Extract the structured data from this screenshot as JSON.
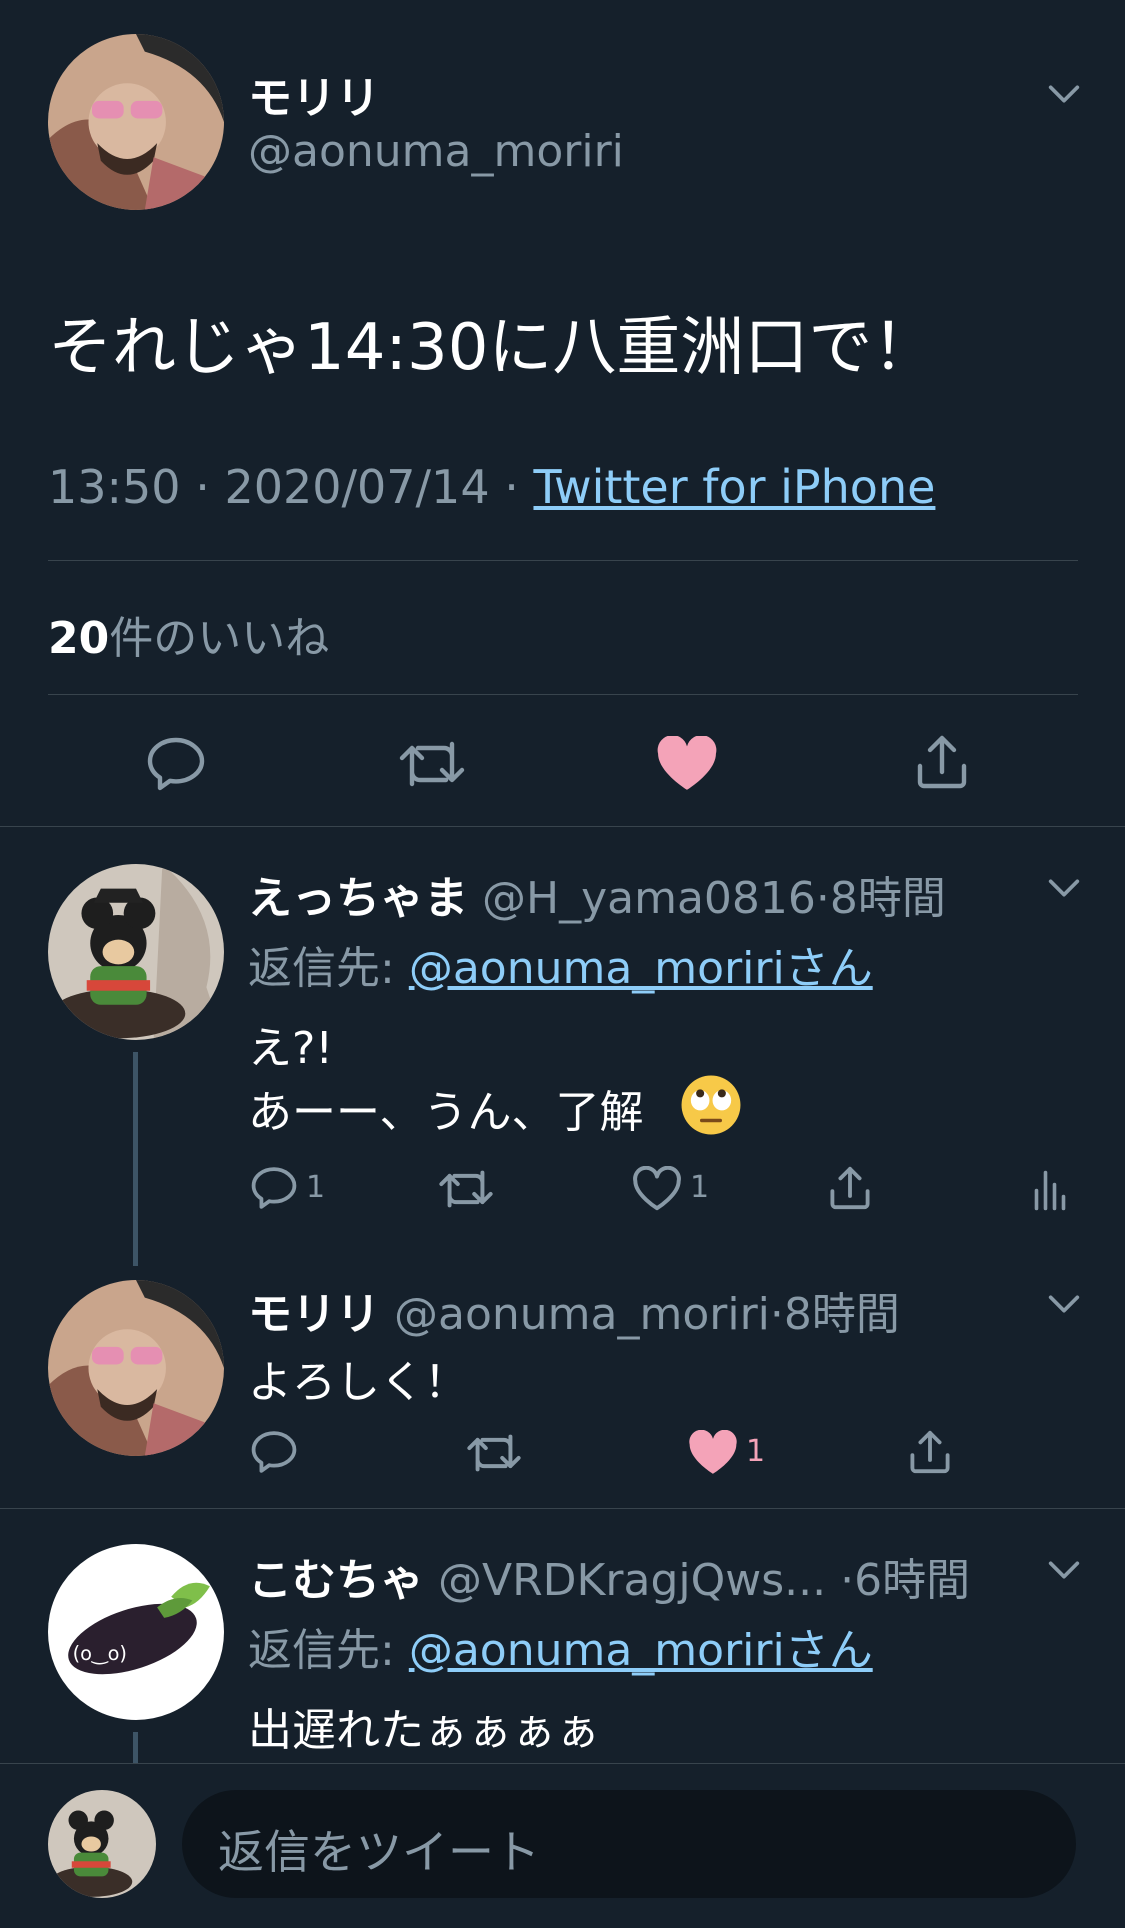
{
  "colors": {
    "background": "#15202b",
    "muted": "#8899a6",
    "link": "#8ecdf8",
    "like": "#f4a3b8",
    "divider": "#38444d"
  },
  "main_tweet": {
    "display_name": "モリリ",
    "handle": "@aonuma_moriri",
    "text": "それじゃ14:30に八重洲口で！",
    "time": "13:50",
    "date": "2020/07/14",
    "source": "Twitter for iPhone",
    "separator": " · ",
    "likes_count": "20",
    "likes_suffix": "件のいいね",
    "icons": [
      "reply-icon",
      "retweet-icon",
      "heart-filled-icon",
      "share-icon"
    ]
  },
  "replies": [
    {
      "display_name": "えっちゃま",
      "handle": "@H_yama0816",
      "time": "8時間",
      "dot": "·",
      "reply_to_label": "返信先: ",
      "reply_to": "@aonuma_moririさん",
      "lines": [
        "え?!",
        "あーー、うん、了解"
      ],
      "emoji": "face-with-rolling-eyes",
      "reply_count": "1",
      "like_count": "1"
    },
    {
      "display_name": "モリリ",
      "handle": "@aonuma_moriri",
      "time": "8時間",
      "dot": "·",
      "lines": [
        "よろしく！"
      ],
      "like_count": "1"
    },
    {
      "display_name": "こむちゃ",
      "handle": "@VRDKragjQws...",
      "time": "6時間",
      "dot": "·",
      "reply_to_label": "返信先: ",
      "reply_to": "@aonuma_moririさん",
      "lines": [
        "出遅れたぁぁぁぁ"
      ]
    }
  ],
  "composer": {
    "placeholder": "返信をツイート"
  }
}
